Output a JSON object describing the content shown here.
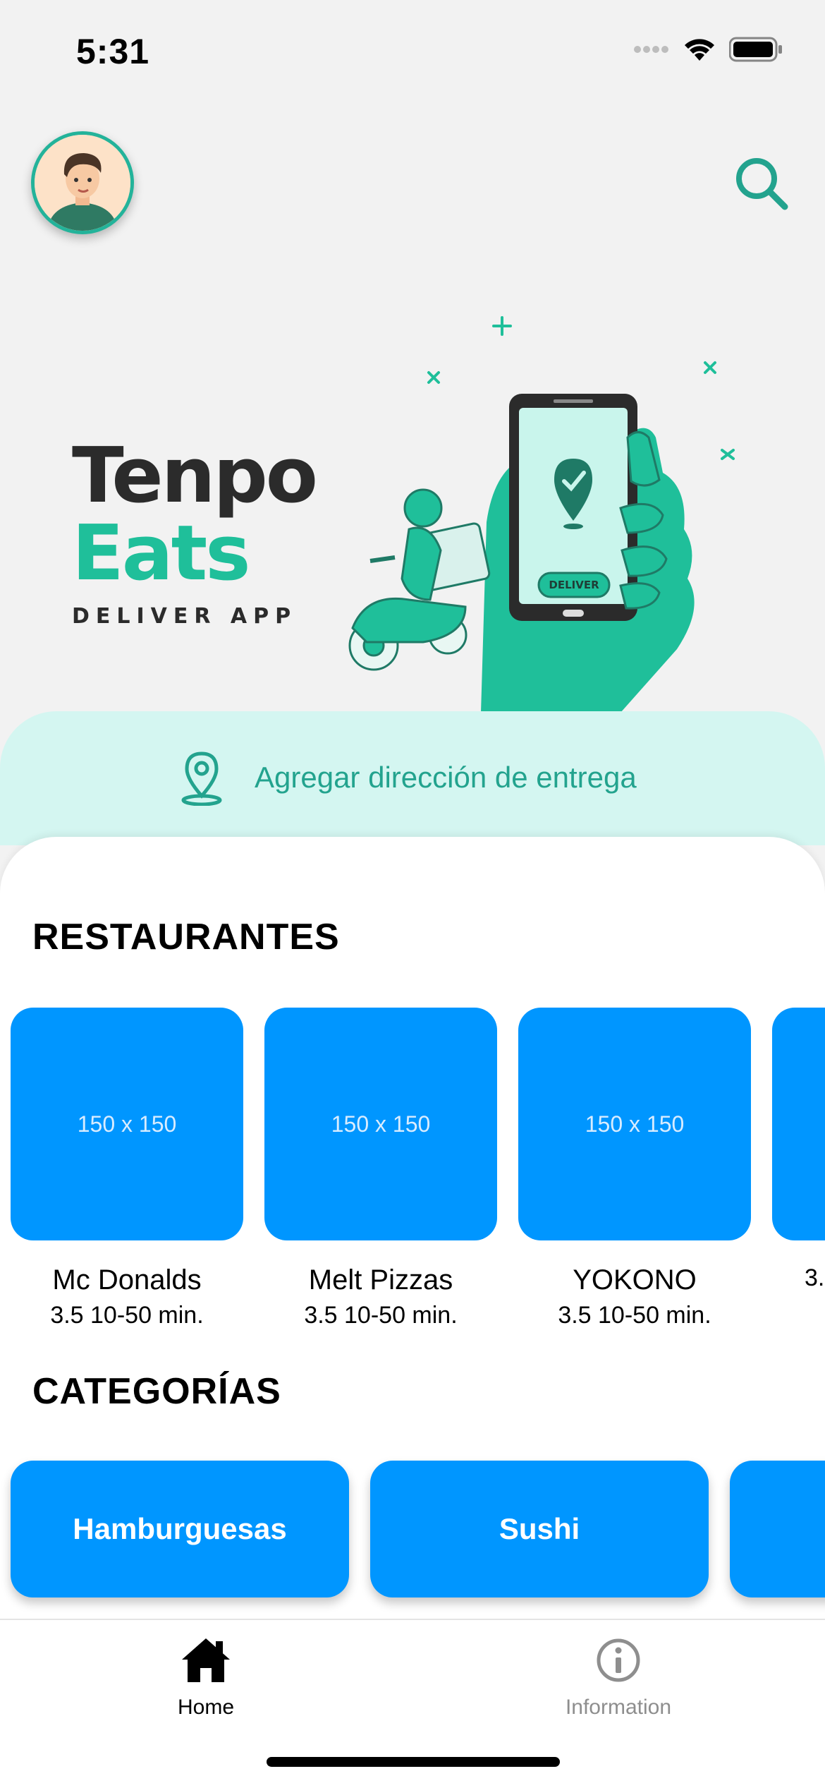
{
  "status_bar": {
    "time": "5:31"
  },
  "brand": {
    "line1": "Tenpo",
    "line2": "Eats",
    "subtitle": "DELIVER APP",
    "phone_badge": "DELIVER"
  },
  "address": {
    "label": "Agregar dirección de entrega"
  },
  "sections": {
    "restaurants_title": "RESTAURANTES",
    "categories_title": "CATEGORÍAS"
  },
  "restaurants": [
    {
      "image_placeholder": "150 x 150",
      "name": "Mc Donalds",
      "meta": "3.5 10-50 min."
    },
    {
      "image_placeholder": "150 x 150",
      "name": "Melt Pizzas",
      "meta": "3.5 10-50 min."
    },
    {
      "image_placeholder": "150 x 150",
      "name": "YOKONO",
      "meta": "3.5 10-50 min."
    },
    {
      "image_placeholder": "",
      "name": "",
      "meta": "3."
    }
  ],
  "categories": [
    {
      "label": "Hamburguesas"
    },
    {
      "label": "Sushi"
    },
    {
      "label": ""
    }
  ],
  "tabbar": {
    "home": "Home",
    "information": "Information",
    "active": "home"
  },
  "colors": {
    "accent": "#1fbf9a",
    "card_blue": "#0096ff",
    "address_bg": "#d4f6f1",
    "inactive_tab": "#8e8e8e"
  }
}
